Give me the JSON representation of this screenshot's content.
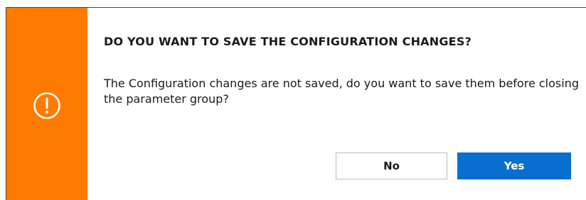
{
  "dialog": {
    "title": "DO YOU WANT TO SAVE THE CONFIGURATION CHANGES?",
    "message": "The Configuration changes are not saved, do you want to save them before closing the parameter group?",
    "icon": "alert-circle-icon",
    "accent_color": "#ff7b00",
    "buttons": {
      "no_label": "No",
      "yes_label": "Yes",
      "primary_color": "#0a6ed1"
    }
  }
}
